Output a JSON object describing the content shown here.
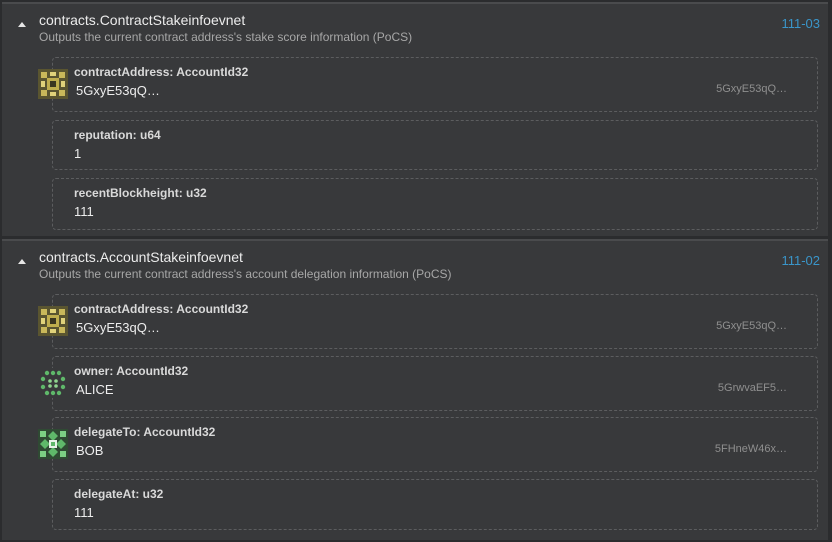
{
  "events": [
    {
      "title": "contracts.ContractStakeinfoevnet",
      "description": "Outputs the current contract address's stake score information (PoCS)",
      "block": "111-03",
      "params": [
        {
          "label": "contractAddress: AccountId32",
          "value": "5GxyE53qQ…",
          "short": "5GxyE53qQ…",
          "avatar": "identicon-gold"
        },
        {
          "label": "reputation: u64",
          "value": "1"
        },
        {
          "label": "recentBlockheight: u32",
          "value": "111"
        }
      ]
    },
    {
      "title": "contracts.AccountStakeinfoevnet",
      "description": "Outputs the current contract address's account delegation information (PoCS)",
      "block": "111-02",
      "params": [
        {
          "label": "contractAddress: AccountId32",
          "value": "5GxyE53qQ…",
          "short": "5GxyE53qQ…",
          "avatar": "identicon-gold"
        },
        {
          "label": "owner: AccountId32",
          "value": "ALICE",
          "short": "5GrwvaEF5…",
          "avatar": "identicon-green-dots"
        },
        {
          "label": "delegateTo: AccountId32",
          "value": "BOB",
          "short": "5FHneW46x…",
          "avatar": "identicon-green-diamond"
        },
        {
          "label": "delegateAt: u32",
          "value": "111"
        }
      ]
    }
  ],
  "colors": {
    "background": "#2b2c2e",
    "card": "#38393b",
    "accent": "#3a95c9",
    "identicon_gold": "#c9b85a",
    "identicon_green": "#5fb86a"
  }
}
